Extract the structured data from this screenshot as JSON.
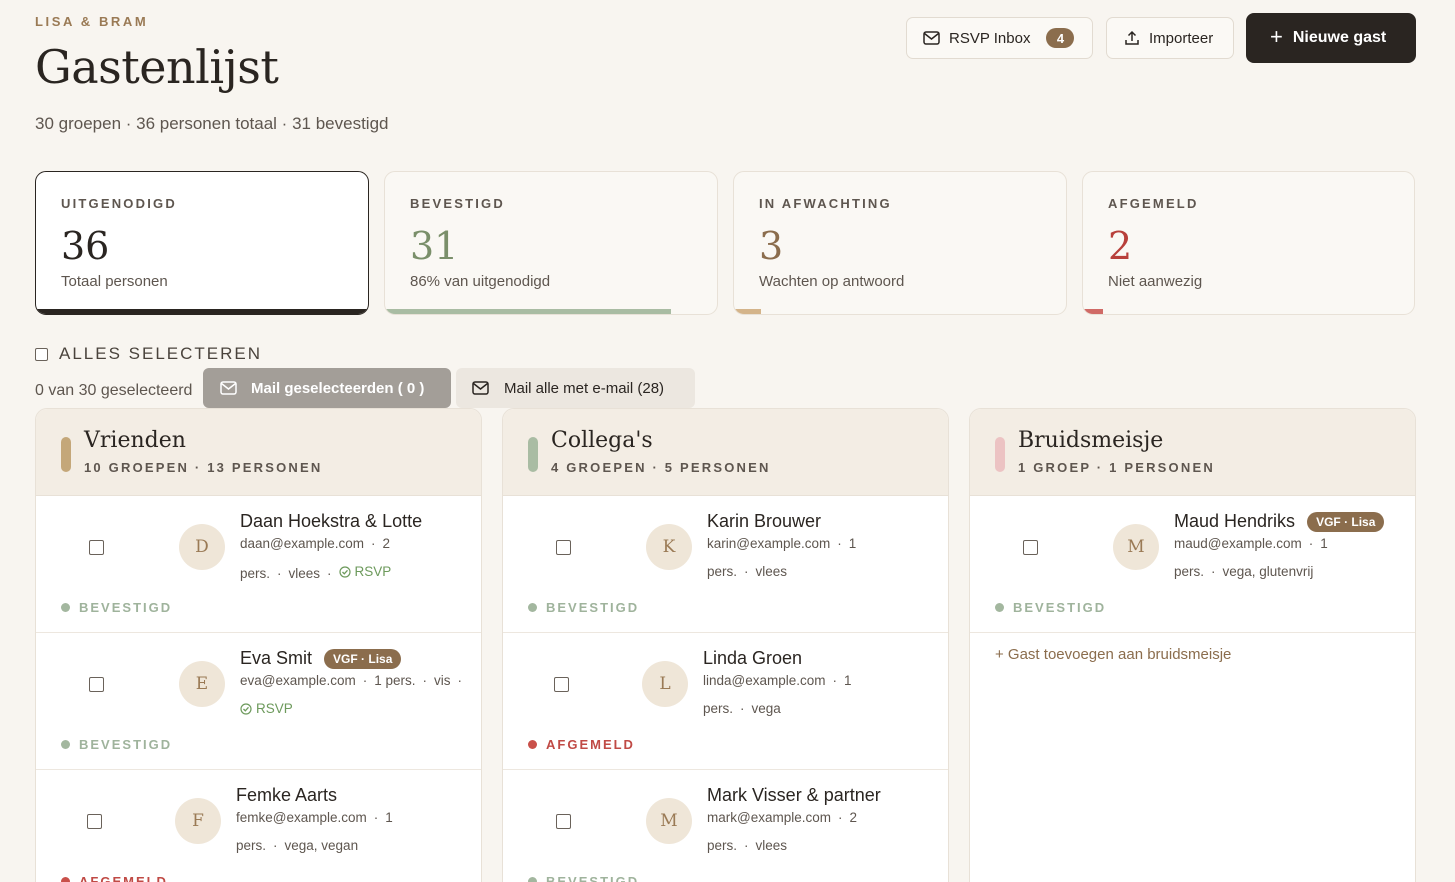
{
  "header": {
    "eyebrow": "LISA & BRAM",
    "title": "Gastenlijst",
    "subtitle": "30 groepen · 36 personen totaal · 31 bevestigd"
  },
  "actions": {
    "rsvp_label": "RSVP Inbox",
    "rsvp_count": "4",
    "import_label": "Importeer",
    "new_label": "Nieuwe gast",
    "new_icon": "plus-icon"
  },
  "stats": [
    {
      "label": "UITGENODIGD",
      "value": "36",
      "desc": "Totaal personen",
      "color": "#2a2521",
      "fill": 1.0
    },
    {
      "label": "BEVESTIGD",
      "value": "31",
      "desc": "86% van uitgenodigd",
      "color": "#7a8f6a",
      "fill": 0.86
    },
    {
      "label": "IN AFWACHTING",
      "value": "3",
      "desc": "Wachten op antwoord",
      "color": "#8b6d4d",
      "fill": 0.08
    },
    {
      "label": "AFGEMELD",
      "value": "2",
      "desc": "Niet aanwezig",
      "color": "#b8403b",
      "fill": 0.06
    }
  ],
  "selection": {
    "select_all": "ALLES SELECTEREN",
    "count_text": "0 van 30 geselecteerd",
    "mail_selected": "Mail geselecteerden ( 0 )",
    "mail_all": "Mail alle met e-mail (28)"
  },
  "columns": [
    {
      "title": "Vrienden",
      "sub": "10 GROEPEN · 13 PERSONEN",
      "color": "#c4a779",
      "guests": [
        {
          "initial": "D",
          "name": "Daan Hoekstra & Lotte",
          "email": "daan@example.com",
          "persons": "2 pers.",
          "diet": "vlees",
          "rsvp": "RSVP",
          "status": "BEVESTIGD"
        },
        {
          "initial": "E",
          "name": "Eva Smit",
          "tag": "VGF · Lisa",
          "email": "eva@example.com",
          "persons": "1 pers.",
          "diet": "vis",
          "rsvp": "RSVP",
          "status": "BEVESTIGD"
        },
        {
          "initial": "F",
          "name": "Femke Aarts",
          "email": "femke@example.com",
          "persons": "1 pers.",
          "diet": "vega, vegan",
          "status": "AFGEMELD"
        }
      ]
    },
    {
      "title": "Collega's",
      "sub": "4 GROEPEN · 5 PERSONEN",
      "color": "#a9bca3",
      "guests": [
        {
          "initial": "K",
          "name": "Karin Brouwer",
          "email": "karin@example.com",
          "persons": "1 pers.",
          "diet": "vlees",
          "status": "BEVESTIGD"
        },
        {
          "initial": "L",
          "name": "Linda Groen",
          "email": "linda@example.com",
          "persons": "1 pers.",
          "diet": "vega",
          "status": "AFGEMELD"
        },
        {
          "initial": "M",
          "name": "Mark Visser & partner",
          "email": "mark@example.com",
          "persons": "2 pers.",
          "diet": "vlees",
          "status": "BEVESTIGD"
        }
      ]
    },
    {
      "title": "Bruidsmeisje",
      "sub": "1 GROEP · 1 PERSONEN",
      "color": "#ecc3c3",
      "guests": [
        {
          "initial": "M",
          "name": "Maud Hendriks",
          "tag": "VGF · Lisa",
          "email": "maud@example.com",
          "persons": "1 pers.",
          "diet": "vega, glutenvrij",
          "status": "BEVESTIGD"
        }
      ],
      "add_label": "+ Gast toevoegen aan bruidsmeisje"
    }
  ]
}
